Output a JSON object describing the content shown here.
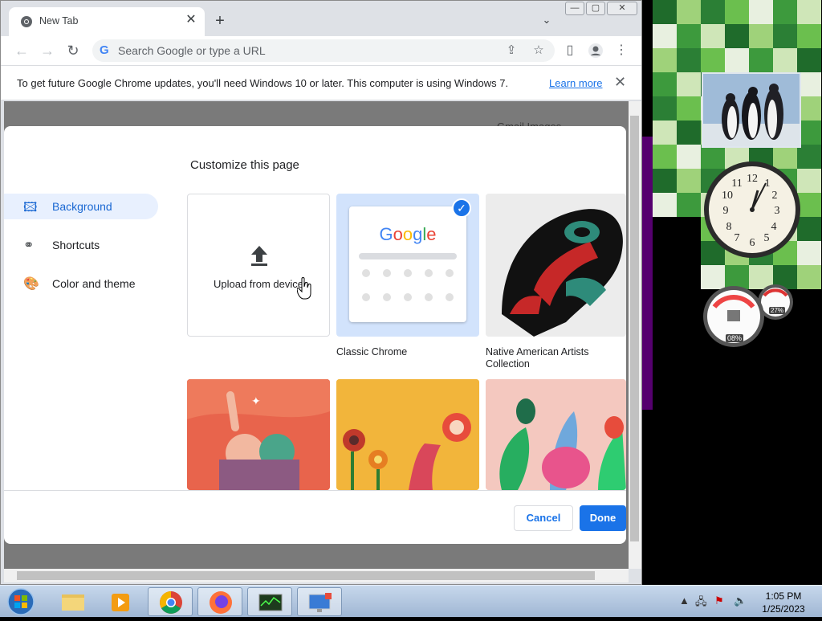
{
  "browser": {
    "tab": {
      "title": "New Tab",
      "close_symbol": "✕"
    },
    "new_tab_symbol": "+",
    "tab_search_symbol": "⌄",
    "window_controls": {
      "minimize": "—",
      "maximize": "▢",
      "close": "✕"
    },
    "omnibox": {
      "placeholder": "Search Google or type a URL",
      "google_glyph": "G"
    },
    "infobar": {
      "message": "To get future Google Chrome updates, you'll need Windows 10 or later. This computer is using Windows 7.",
      "link": "Learn more",
      "close_symbol": "✕"
    },
    "ntp_links": "Gmail   Images"
  },
  "dialog": {
    "title": "Customize this page",
    "sidebar": [
      {
        "label": "Background",
        "icon": "image-icon",
        "selected": true
      },
      {
        "label": "Shortcuts",
        "icon": "link-icon",
        "selected": false
      },
      {
        "label": "Color and theme",
        "icon": "palette-icon",
        "selected": false
      }
    ],
    "tiles": {
      "upload": "Upload from device",
      "classic_logo": "Google",
      "classic": "Classic Chrome",
      "native_line1": "Native American Artists",
      "native_line2": "Collection"
    },
    "cancel": "Cancel",
    "done": "Done"
  },
  "gadgets": {
    "cpu": "08%",
    "mem": "27%"
  },
  "taskbar": {
    "time": "1:05 PM",
    "date": "1/25/2023",
    "items": [
      "windows-explorer",
      "media-player",
      "chrome",
      "firefox",
      "task-manager",
      "remote-desktop"
    ]
  },
  "colors": {
    "accent": "#1a73e8",
    "selected_bg": "#e8f0fe"
  }
}
